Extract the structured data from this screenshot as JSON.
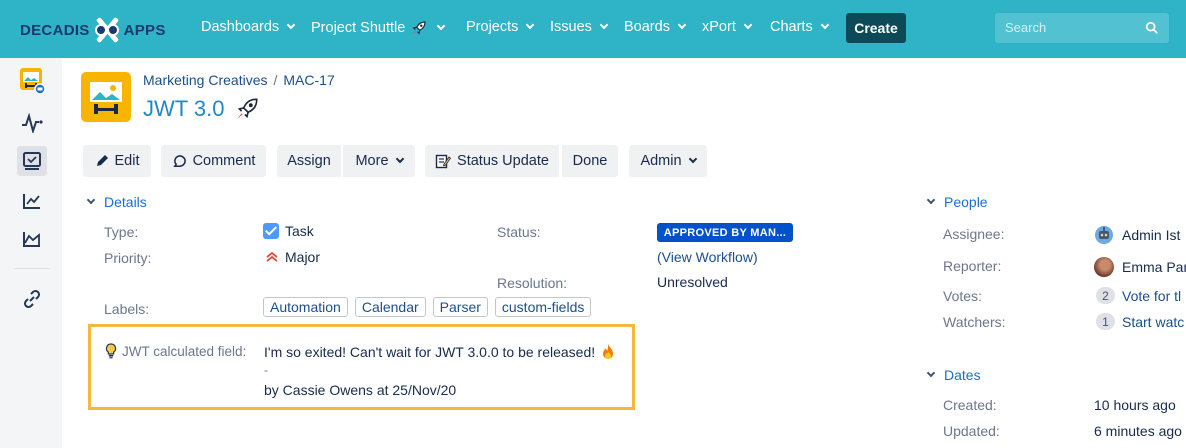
{
  "brand": {
    "left": "DECADIS",
    "right": "APPS"
  },
  "nav": [
    "Dashboards",
    "Project Shuttle",
    "Projects",
    "Issues",
    "Boards",
    "xPort",
    "Charts"
  ],
  "create_label": "Create",
  "search": {
    "placeholder": "Search"
  },
  "breadcrumb": {
    "project": "Marketing Creatives",
    "separator": "/",
    "key": "MAC-17"
  },
  "issue_title": "JWT 3.0",
  "toolbar": {
    "edit": "Edit",
    "comment": "Comment",
    "assign": "Assign",
    "more": "More",
    "status_update": "Status Update",
    "done": "Done",
    "admin": "Admin"
  },
  "details": {
    "heading": "Details",
    "type_label": "Type:",
    "type_value": "Task",
    "priority_label": "Priority:",
    "priority_value": "Major",
    "status_label": "Status:",
    "status_value": "APPROVED BY MAN...",
    "view_workflow": "(View Workflow)",
    "resolution_label": "Resolution:",
    "resolution_value": "Unresolved",
    "labels_label": "Labels:",
    "labels": [
      "Automation",
      "Calendar",
      "Parser",
      "custom-fields"
    ]
  },
  "jwt_field": {
    "label": "JWT calculated field:",
    "line1": "I'm so exited! Can't wait for JWT 3.0.0 to be released!",
    "dash": "-",
    "line2": "by Cassie Owens at 25/Nov/20"
  },
  "people": {
    "heading": "People",
    "assignee_label": "Assignee:",
    "assignee_value": "Admin Ist",
    "reporter_label": "Reporter:",
    "reporter_value": "Emma Par",
    "votes_label": "Votes:",
    "votes_count": "2",
    "votes_link": "Vote for tl",
    "watchers_label": "Watchers:",
    "watchers_count": "1",
    "watchers_link": "Start watc"
  },
  "dates": {
    "heading": "Dates",
    "created_label": "Created:",
    "created_value": "10 hours ago",
    "updated_label": "Updated:",
    "updated_value": "6 minutes ago"
  },
  "colors": {
    "topbar": "#2fb3c6",
    "create_button": "#0c4a57",
    "link": "#1b4f8c",
    "status_lozenge": "#0052cc",
    "jwt_border": "#f5b83d"
  }
}
